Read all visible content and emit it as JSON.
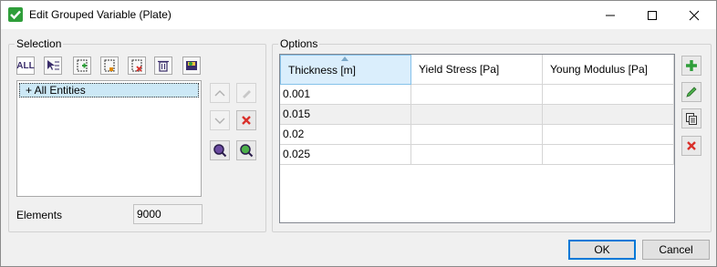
{
  "window": {
    "title": "Edit Grouped Variable (Plate)"
  },
  "selection": {
    "label": "Selection",
    "toolbar": {
      "all_label": "ALL"
    },
    "list_items": [
      "+ All Entities"
    ],
    "elements_label": "Elements",
    "elements_value": "9000"
  },
  "options": {
    "label": "Options",
    "columns": [
      "Thickness [m]",
      "Yield Stress [Pa]",
      "Young Modulus [Pa]"
    ],
    "rows": [
      [
        "0.001",
        "",
        ""
      ],
      [
        "0.015",
        "",
        ""
      ],
      [
        "0.02",
        "",
        ""
      ],
      [
        "0.025",
        "",
        ""
      ]
    ]
  },
  "footer": {
    "ok_label": "OK",
    "cancel_label": "Cancel"
  },
  "colors": {
    "accent": "#2f9e3a",
    "delete": "#d9302a",
    "selection_bg": "#cce8f6",
    "header_active": "#daeefc"
  }
}
